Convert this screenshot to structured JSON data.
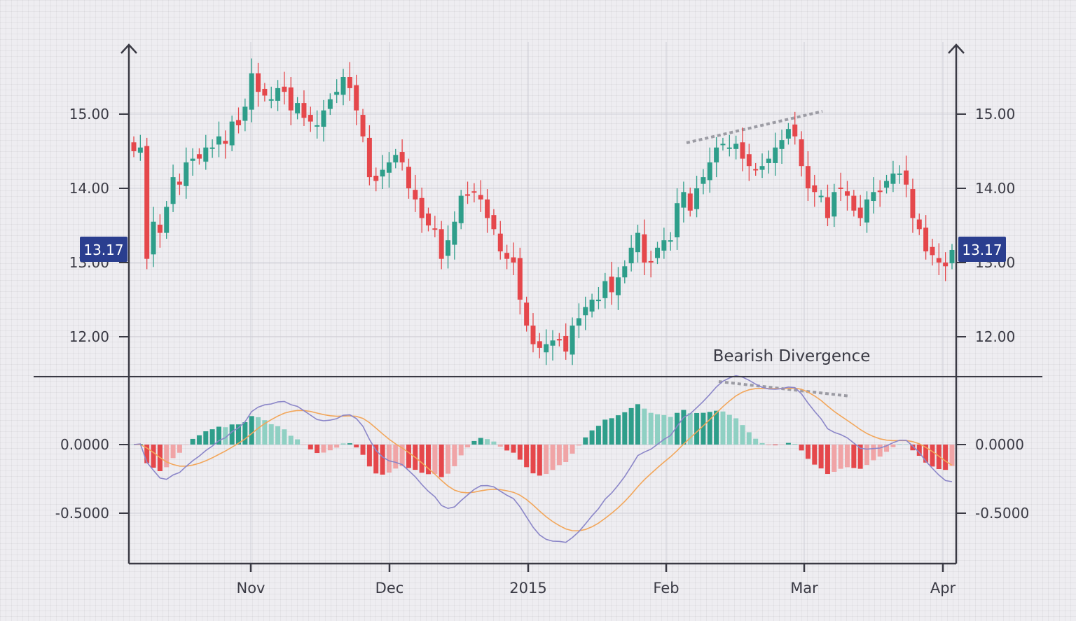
{
  "chart_data": [
    {
      "type": "candlestick",
      "panel": "price",
      "ylim": [
        11.5,
        16.0
      ],
      "y_ticks": [
        12.0,
        13.0,
        14.0,
        15.0
      ],
      "y_tick_labels": [
        "12.00",
        "13.00",
        "14.00",
        "15.00"
      ],
      "grid": true,
      "current_price_label": "13.17",
      "annotation": "Bearish Divergence",
      "colors": {
        "up": "#2e9e8a",
        "down": "#e5474b",
        "price_tag": "#2a3e8f"
      },
      "closes": [
        14.5,
        14.55,
        13.05,
        13.55,
        13.4,
        13.75,
        14.15,
        14.05,
        14.35,
        14.4,
        14.4,
        14.55,
        14.55,
        14.7,
        14.6,
        14.9,
        14.85,
        15.1,
        15.55,
        15.3,
        15.25,
        15.2,
        15.35,
        15.3,
        15.05,
        15.15,
        14.95,
        14.9,
        14.85,
        15.05,
        15.2,
        15.3,
        15.5,
        15.35,
        15.05,
        14.7,
        14.15,
        14.1,
        14.25,
        14.35,
        14.45,
        14.35,
        14.0,
        13.85,
        13.6,
        13.5,
        13.45,
        13.05,
        13.3,
        13.55,
        13.9,
        13.9,
        13.95,
        13.85,
        13.6,
        13.45,
        13.15,
        13.05,
        13.0,
        12.5,
        12.15,
        11.9,
        11.85,
        11.9,
        11.95,
        11.95,
        11.8,
        12.15,
        12.25,
        12.4,
        12.5,
        12.5,
        12.75,
        12.6,
        12.8,
        12.95,
        13.2,
        13.4,
        13.0,
        13.0,
        13.2,
        13.3,
        13.3,
        13.8,
        13.95,
        13.7,
        14.0,
        14.15,
        14.35,
        14.55,
        14.6,
        14.55,
        14.6,
        14.4,
        14.3,
        14.25,
        14.3,
        14.4,
        14.55,
        14.65,
        14.8,
        14.7,
        14.3,
        14.0,
        13.95,
        13.9,
        13.6,
        13.95,
        14.0,
        13.9,
        13.7,
        13.6,
        13.85,
        13.95,
        13.95,
        14.1,
        14.2,
        14.2,
        14.05,
        13.6,
        13.45,
        13.15,
        13.1,
        13.0,
        12.95,
        13.17
      ],
      "ohlc_note": "one candle per trading day, Oct 2014 – Apr 2015"
    },
    {
      "type": "macd",
      "panel": "indicator",
      "ylim": [
        -0.85,
        0.45
      ],
      "y_ticks": [
        -0.5,
        0.0
      ],
      "y_tick_labels": [
        "-0.5000",
        "0.0000"
      ],
      "series": [
        {
          "values": "macd_line",
          "color": "#8b86c8"
        },
        {
          "values": "signal_line",
          "color": "#f2a65a"
        },
        {
          "values": "histogram",
          "color_pos": "#2e9e8a",
          "color_neg": "#e5474b"
        }
      ],
      "x_tick_labels": [
        "Nov",
        "Dec",
        "2015",
        "Feb",
        "Mar",
        "Apr"
      ]
    }
  ]
}
